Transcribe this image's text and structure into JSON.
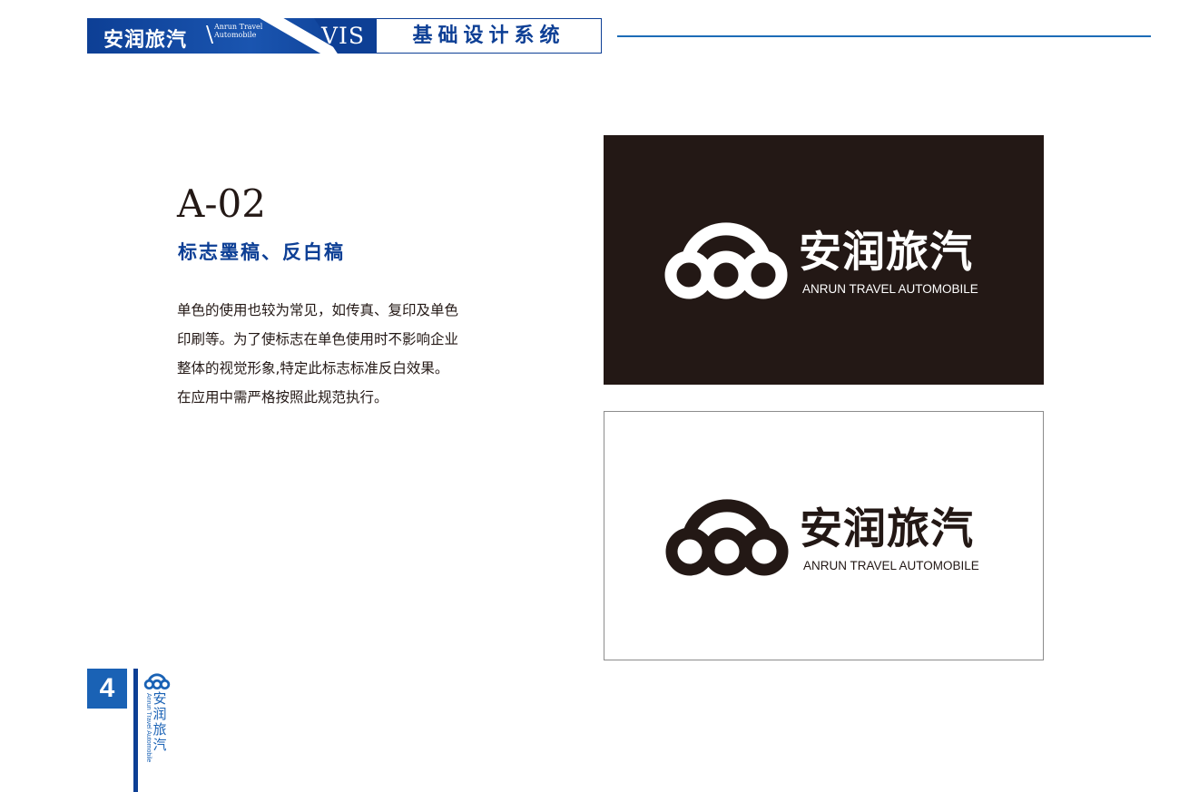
{
  "colors": {
    "brand_blue": "#0d3f95",
    "accent_blue": "#1a62b5",
    "rule_blue": "#1d6cb7",
    "ink": "#231815",
    "white": "#ffffff"
  },
  "header": {
    "brand_cn": "安润旅汽",
    "brand_slash": "\\",
    "brand_en": "Anrun Travel Automobile",
    "vis": "VIS",
    "title": "基础设计系统"
  },
  "section": {
    "code": "A-02",
    "title": "标志墨稿、反白稿",
    "body": "单色的使用也较为常见，如传真、复印及单色印刷等。为了使标志在单色使用时不影响企业整体的视觉形象,特定此标志标准反白效果。在应用中需严格按照此规范执行。"
  },
  "logo": {
    "name_cn": "安润旅汽",
    "name_en": "ANRUN TRAVEL AUTOMOBILE",
    "icon": "three-rings-arc-icon"
  },
  "footer": {
    "page_number": "4",
    "brand_cn": "安润旅汽",
    "brand_en": "Anrun Travel Automobile"
  }
}
